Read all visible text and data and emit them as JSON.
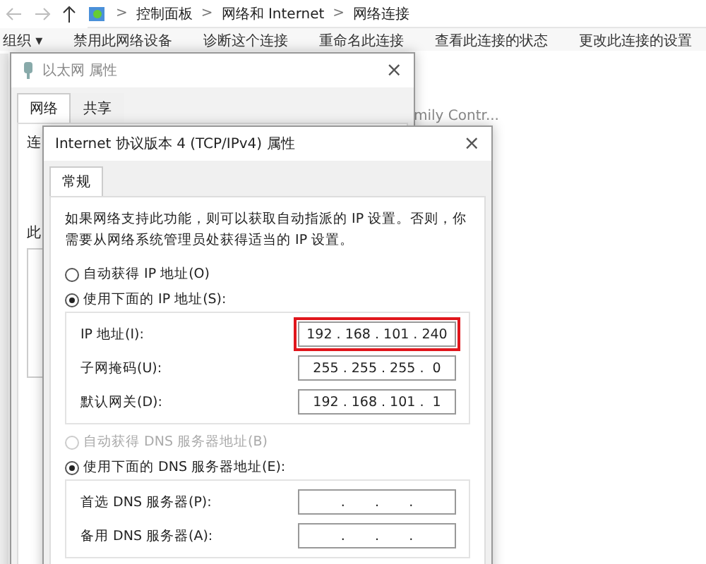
{
  "explorer": {
    "breadcrumb": [
      "控制面板",
      "网络和 Internet",
      "网络连接"
    ],
    "separator": ">",
    "toolbar": [
      "组织 ▾",
      "禁用此网络设备",
      "诊断这个连接",
      "重命名此连接",
      "查看此连接的状态",
      "更改此连接的设置"
    ],
    "item_text": "mily Contr..."
  },
  "ethernet_dialog": {
    "title": "以太网 属性",
    "close": "×",
    "tabs": [
      {
        "label": "网络",
        "selected": true
      },
      {
        "label": "共享",
        "selected": false
      }
    ],
    "labels": [
      "连",
      "此"
    ]
  },
  "ipv4_dialog": {
    "title": "Internet 协议版本 4 (TCP/IPv4) 属性",
    "close": "×",
    "tabs": [
      {
        "label": "常规",
        "selected": true
      }
    ],
    "description": "如果网络支持此功能，则可以获取自动指派的 IP 设置。否则，你需要从网络系统管理员处获得适当的 IP 设置。",
    "ip_options": [
      {
        "label": "自动获得 IP 地址(O)",
        "selected": false,
        "disabled": false
      },
      {
        "label": "使用下面的 IP 地址(S):",
        "selected": true,
        "disabled": false
      }
    ],
    "ip_fields": [
      {
        "label": "IP 地址(I):",
        "value": "192 . 168 . 101 . 240",
        "highlighted": true
      },
      {
        "label": "子网掩码(U):",
        "value": "255 . 255 . 255 .  0",
        "highlighted": false
      },
      {
        "label": "默认网关(D):",
        "value": "192 . 168 . 101 .  1",
        "highlighted": false
      }
    ],
    "dns_options": [
      {
        "label": "自动获得 DNS 服务器地址(B)",
        "selected": false,
        "disabled": true
      },
      {
        "label": "使用下面的 DNS 服务器地址(E):",
        "selected": true,
        "disabled": false
      }
    ],
    "dns_fields": [
      {
        "label": "首选 DNS 服务器(P):",
        "value": ".       .       .",
        "highlighted": false
      },
      {
        "label": "备用 DNS 服务器(A):",
        "value": ".       .       .",
        "highlighted": false
      }
    ]
  }
}
